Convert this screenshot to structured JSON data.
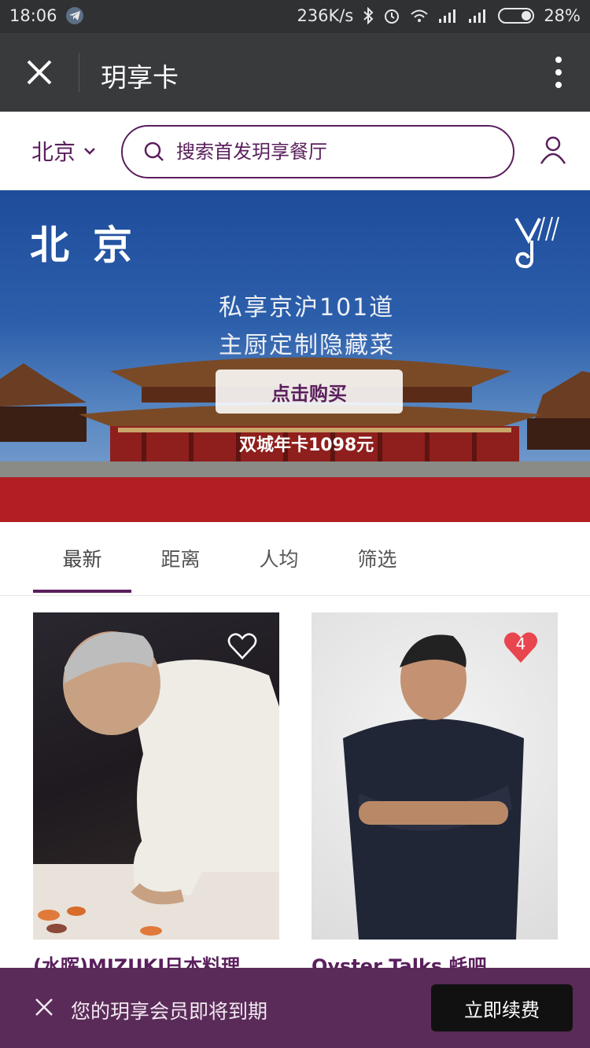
{
  "status_bar": {
    "time": "18:06",
    "speed": "236K/s",
    "battery": "28%"
  },
  "title_bar": {
    "title": "玥享卡"
  },
  "search": {
    "city": "北京",
    "placeholder": "搜索首发玥享餐厅"
  },
  "banner": {
    "city": "北京",
    "line1": "私享京沪101道",
    "line2": "主厨定制隐藏菜",
    "button": "点击购买",
    "price": "双城年卡1098元"
  },
  "tabs": [
    {
      "label": "最新",
      "active": true
    },
    {
      "label": "距离",
      "active": false
    },
    {
      "label": "人均",
      "active": false
    },
    {
      "label": "筛选",
      "active": false
    }
  ],
  "cards": [
    {
      "name": "(水晖)MIZUKI日本料理",
      "liked": false,
      "like_count": ""
    },
    {
      "name": "Oyster Talks 蚝吧",
      "liked": true,
      "like_count": "4"
    }
  ],
  "bottom_bar": {
    "message": "您的玥享会员即将到期",
    "button": "立即续费"
  },
  "colors": {
    "brand": "#5a1f5c",
    "like": "#e8454f"
  }
}
